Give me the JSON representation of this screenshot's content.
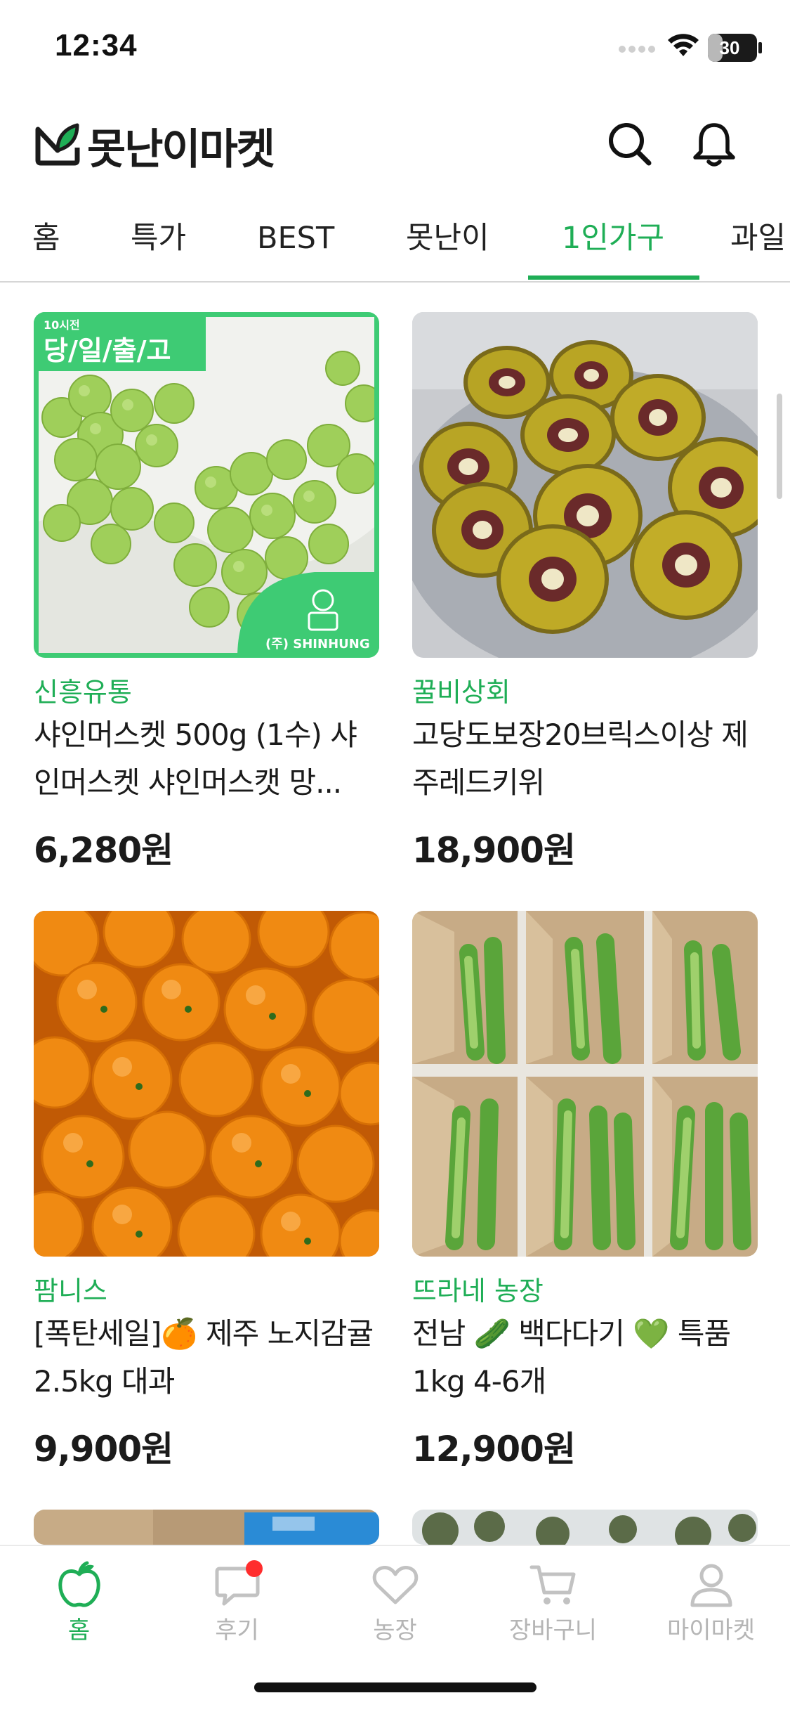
{
  "status_bar": {
    "time": "12:34",
    "battery_level": "30",
    "battery_fraction": 0.3
  },
  "header": {
    "logo_text": "못난이마켓",
    "icons": {
      "logo": "logo-icon",
      "search": "search-icon",
      "notifications": "bell-icon"
    }
  },
  "categories": {
    "tabs": [
      "홈",
      "특가",
      "BEST",
      "못난이",
      "1인가구",
      "과일"
    ],
    "active": "1인가구"
  },
  "products": [
    {
      "seller": "신흥유통",
      "name": "샤인머스켓 500g (1수) 샤인머스켓 샤인머스캣 망...",
      "price": "6,280원",
      "image_badge_small": "10시전",
      "image_badge": "당/일/출/고",
      "image_brand": "(주) SHINHUNG"
    },
    {
      "seller": "꿀비상회",
      "name": "고당도보장20브릭스이상 제주레드키위",
      "price": "18,900원"
    },
    {
      "seller": "팜니스",
      "name": "[폭탄세일]🍊 제주 노지감귤 2.5kg 대과",
      "price": "9,900원"
    },
    {
      "seller": "뜨라네 농장",
      "name": "전남 🥒 백다다기 💚 특품 1kg 4-6개",
      "price": "12,900원"
    }
  ],
  "tab_bar": {
    "items": [
      {
        "label": "홈",
        "icon": "apple-icon",
        "active": true
      },
      {
        "label": "후기",
        "icon": "chat-bubble-icon",
        "badge": true
      },
      {
        "label": "농장",
        "icon": "heart-icon"
      },
      {
        "label": "장바구니",
        "icon": "cart-icon"
      },
      {
        "label": "마이마켓",
        "icon": "person-icon"
      }
    ]
  },
  "colors": {
    "accent": "#1fae56",
    "text": "#1b1b1b",
    "inactive": "#b5b5b5",
    "badge": "#ff2d2d"
  }
}
